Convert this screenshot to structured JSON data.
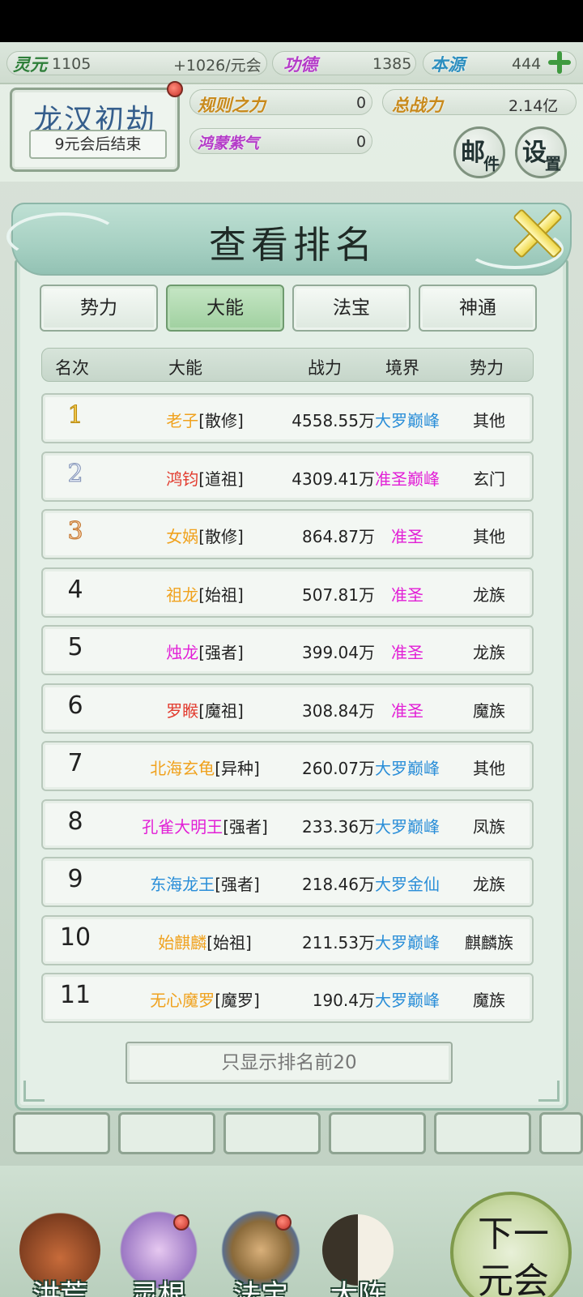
{
  "stats": {
    "lingyuan_label": "灵元",
    "lingyuan_value": "1105",
    "lingyuan_rate": "+1026/元会",
    "gongde_label": "功德",
    "gongde_value": "1385",
    "benyuan_label": "本源",
    "benyuan_value": "444"
  },
  "header": {
    "era_title": "龙汉初劫",
    "era_sub": "9元会后结束",
    "rule_label": "规则之力",
    "rule_value": "0",
    "power_label": "总战力",
    "power_value": "2.14亿",
    "hongmeng_label": "鸿蒙紫气",
    "hongmeng_value": "0",
    "mail_big": "邮",
    "mail_small": "件",
    "settings_big": "设",
    "settings_small": "置"
  },
  "modal": {
    "title": "查看排名",
    "tabs": [
      {
        "label": "势力",
        "active": false
      },
      {
        "label": "大能",
        "active": true
      },
      {
        "label": "法宝",
        "active": false
      },
      {
        "label": "神通",
        "active": false
      }
    ],
    "columns": [
      "名次",
      "大能",
      "战力",
      "境界",
      "势力"
    ],
    "bottom_button": "只显示排名前20"
  },
  "rankings": [
    {
      "rank": "1",
      "name": "老子",
      "title": "[散修]",
      "power": "4558.55万",
      "realm": "大罗巅峰",
      "faction": "其他",
      "name_color": "#f0a21e",
      "realm_color": "#2a8ed8"
    },
    {
      "rank": "2",
      "name": "鸿钧",
      "title": "[道祖]",
      "power": "4309.41万",
      "realm": "准圣巅峰",
      "faction": "玄门",
      "name_color": "#e23b2e",
      "realm_color": "#e21fd6"
    },
    {
      "rank": "3",
      "name": "女娲",
      "title": "[散修]",
      "power": "864.87万",
      "realm": "准圣",
      "faction": "其他",
      "name_color": "#f0a21e",
      "realm_color": "#e21fd6"
    },
    {
      "rank": "4",
      "name": "祖龙",
      "title": "[始祖]",
      "power": "507.81万",
      "realm": "准圣",
      "faction": "龙族",
      "name_color": "#f0a21e",
      "realm_color": "#e21fd6"
    },
    {
      "rank": "5",
      "name": "烛龙",
      "title": "[强者]",
      "power": "399.04万",
      "realm": "准圣",
      "faction": "龙族",
      "name_color": "#e21fd6",
      "realm_color": "#e21fd6"
    },
    {
      "rank": "6",
      "name": "罗睺",
      "title": "[魔祖]",
      "power": "308.84万",
      "realm": "准圣",
      "faction": "魔族",
      "name_color": "#e23b2e",
      "realm_color": "#e21fd6"
    },
    {
      "rank": "7",
      "name": "北海玄龟",
      "title": "[异种]",
      "power": "260.07万",
      "realm": "大罗巅峰",
      "faction": "其他",
      "name_color": "#f0a21e",
      "realm_color": "#2a8ed8"
    },
    {
      "rank": "8",
      "name": "孔雀大明王",
      "title": "[强者]",
      "power": "233.36万",
      "realm": "大罗巅峰",
      "faction": "凤族",
      "name_color": "#e21fd6",
      "realm_color": "#2a8ed8"
    },
    {
      "rank": "9",
      "name": "东海龙王",
      "title": "[强者]",
      "power": "218.46万",
      "realm": "大罗金仙",
      "faction": "龙族",
      "name_color": "#2a8ed8",
      "realm_color": "#2a8ed8"
    },
    {
      "rank": "10",
      "name": "始麒麟",
      "title": "[始祖]",
      "power": "211.53万",
      "realm": "大罗巅峰",
      "faction": "麒麟族",
      "name_color": "#f0a21e",
      "realm_color": "#2a8ed8"
    },
    {
      "rank": "11",
      "name": "无心魔罗",
      "title": "[魔罗]",
      "power": "190.4万",
      "realm": "大罗巅峰",
      "faction": "魔族",
      "name_color": "#f0a21e",
      "realm_color": "#2a8ed8"
    }
  ],
  "nav": {
    "items": [
      {
        "label": "洪荒",
        "icon": "mountain-icon"
      },
      {
        "label": "灵根",
        "icon": "lotus-icon"
      },
      {
        "label": "法宝",
        "icon": "artifact-icon"
      },
      {
        "label": "大阵",
        "icon": "taiji-icon"
      }
    ],
    "next_label": "下一元会"
  }
}
